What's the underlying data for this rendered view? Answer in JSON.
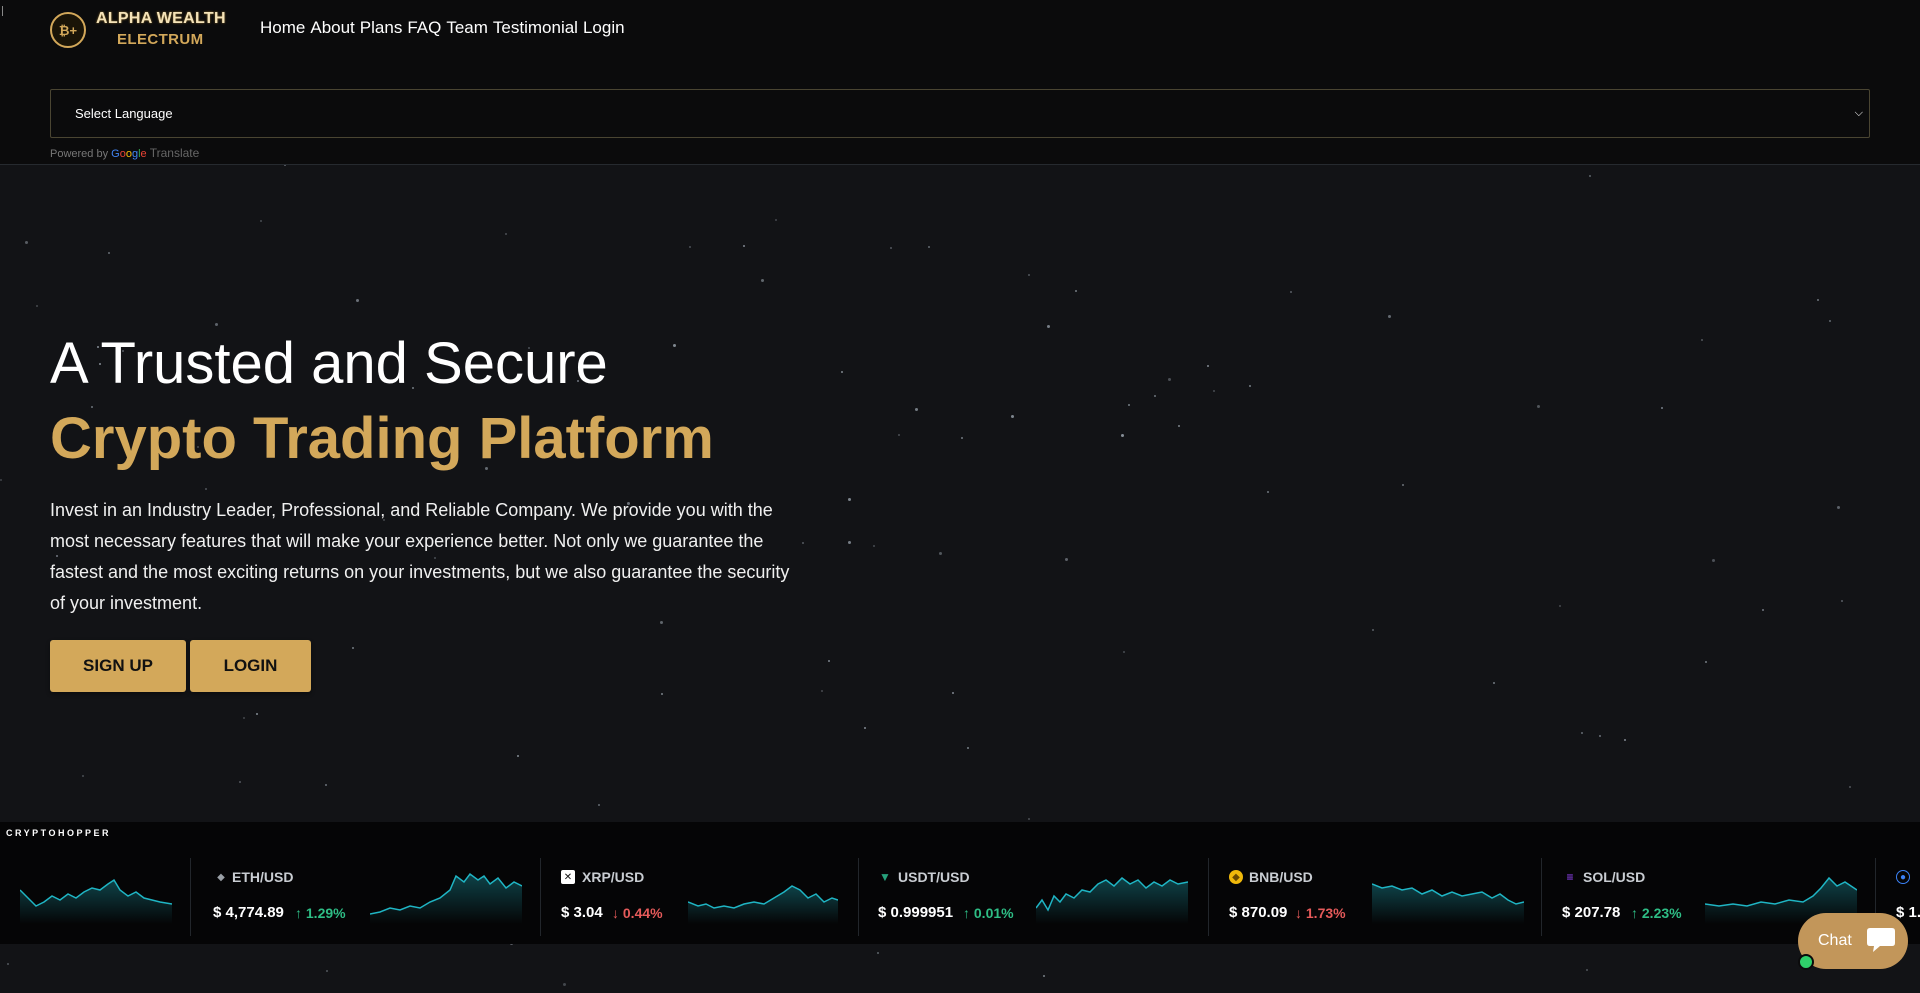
{
  "brand": {
    "name_line1": "ALPHA WEALTH",
    "name_line2": "ELECTRUM",
    "badge": "₿+"
  },
  "nav": {
    "items": [
      "Home",
      "About",
      "Plans",
      "FAQ",
      "Team",
      "Testimonial",
      "Login"
    ]
  },
  "language": {
    "selected": "Select Language",
    "powered_prefix": "Powered by",
    "powered_google": "Google",
    "powered_suffix": "Translate"
  },
  "hero": {
    "title_line1": "A Trusted and Secure",
    "title_line2": "Crypto Trading Platform",
    "description": "Invest in an Industry Leader, Professional, and Reliable Company. We provide you with the most necessary features that will make your experience better. Not only we guarantee the fastest and the most exciting returns on your investments, but we also guarantee the security of your investment.",
    "signup_label": "SIGN UP",
    "login_label": "LOGIN"
  },
  "ticker": {
    "brand": "CRYPTOHOPPER",
    "items": [
      {
        "pair": "ETH/USD",
        "price": "$ 4,774.89",
        "change": "1.29%",
        "direction": "up",
        "icon": "ethereum-icon"
      },
      {
        "pair": "XRP/USD",
        "price": "$ 3.04",
        "change": "0.44%",
        "direction": "down",
        "icon": "xrp-icon"
      },
      {
        "pair": "USDT/USD",
        "price": "$ 0.999951",
        "change": "0.01%",
        "direction": "up",
        "icon": "tether-icon"
      },
      {
        "pair": "BNB/USD",
        "price": "$ 870.09",
        "change": "1.73%",
        "direction": "down",
        "icon": "bnb-icon"
      },
      {
        "pair": "SOL/USD",
        "price": "$ 207.78",
        "change": "2.23%",
        "direction": "up",
        "icon": "solana-icon"
      },
      {
        "pair": "",
        "price": "$ 1.",
        "change": "",
        "direction": "up",
        "icon": "coin-icon"
      }
    ]
  },
  "chat": {
    "label": "Chat"
  },
  "colors": {
    "accent": "#d3a85a",
    "background": "#121316",
    "up": "#2ebd85",
    "down": "#e55a5a",
    "spark": "#1fb5c4"
  }
}
